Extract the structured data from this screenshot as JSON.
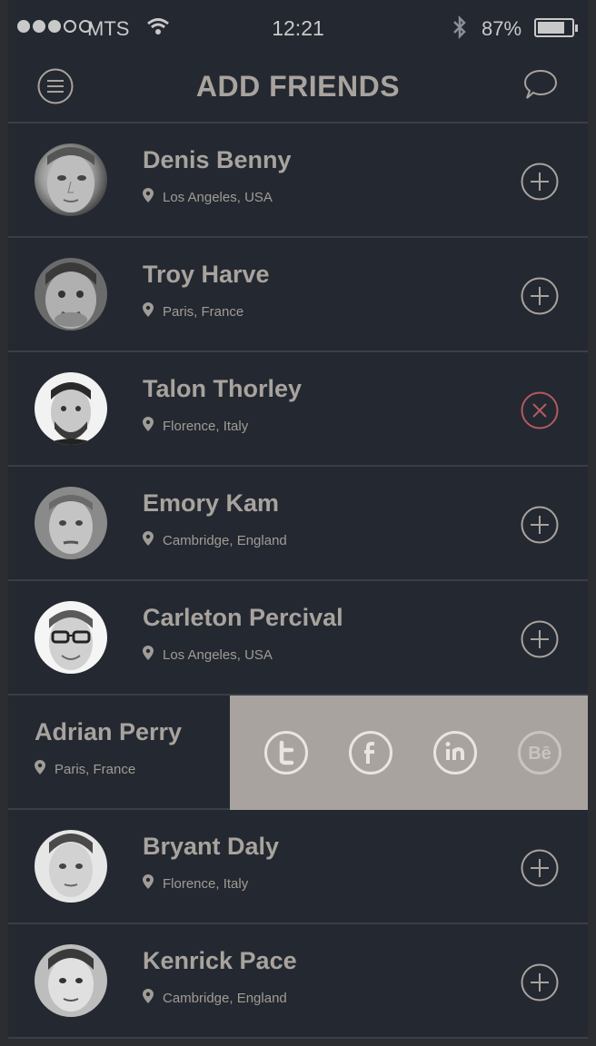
{
  "status_bar": {
    "carrier": "MTS",
    "time": "12:21",
    "battery": "87%",
    "signal_bars_filled": 3,
    "signal_bars_total": 5
  },
  "nav": {
    "title": "ADD FRIENDS",
    "left_icon": "menu-icon",
    "right_icon": "chat-bubble-icon"
  },
  "colors": {
    "background": "#242830",
    "text": "#a8a39e",
    "divider": "#3a3e46",
    "remove_accent": "#b25a62",
    "share_panel": "#a8a39e"
  },
  "friends": [
    {
      "name": "Denis Benny",
      "location": "Los Angeles, USA",
      "action": "add"
    },
    {
      "name": "Troy Harve",
      "location": "Paris, France",
      "action": "add"
    },
    {
      "name": "Talon Thorley",
      "location": "Florence, Italy",
      "action": "remove"
    },
    {
      "name": "Emory Kam",
      "location": "Cambridge, England",
      "action": "add"
    },
    {
      "name": "Carleton Percival",
      "location": "Los Angeles, USA",
      "action": "add"
    },
    {
      "name": "Adrian Perry",
      "location": "Paris, France",
      "action": "share",
      "share_icons": [
        "twitter-icon",
        "facebook-icon",
        "linkedin-icon",
        "behance-icon"
      ]
    },
    {
      "name": "Bryant Daly",
      "location": "Florence, Italy",
      "action": "add"
    },
    {
      "name": "Kenrick Pace",
      "location": "Cambridge, England",
      "action": "add"
    }
  ],
  "share_labels": {
    "behance": "Bē"
  }
}
